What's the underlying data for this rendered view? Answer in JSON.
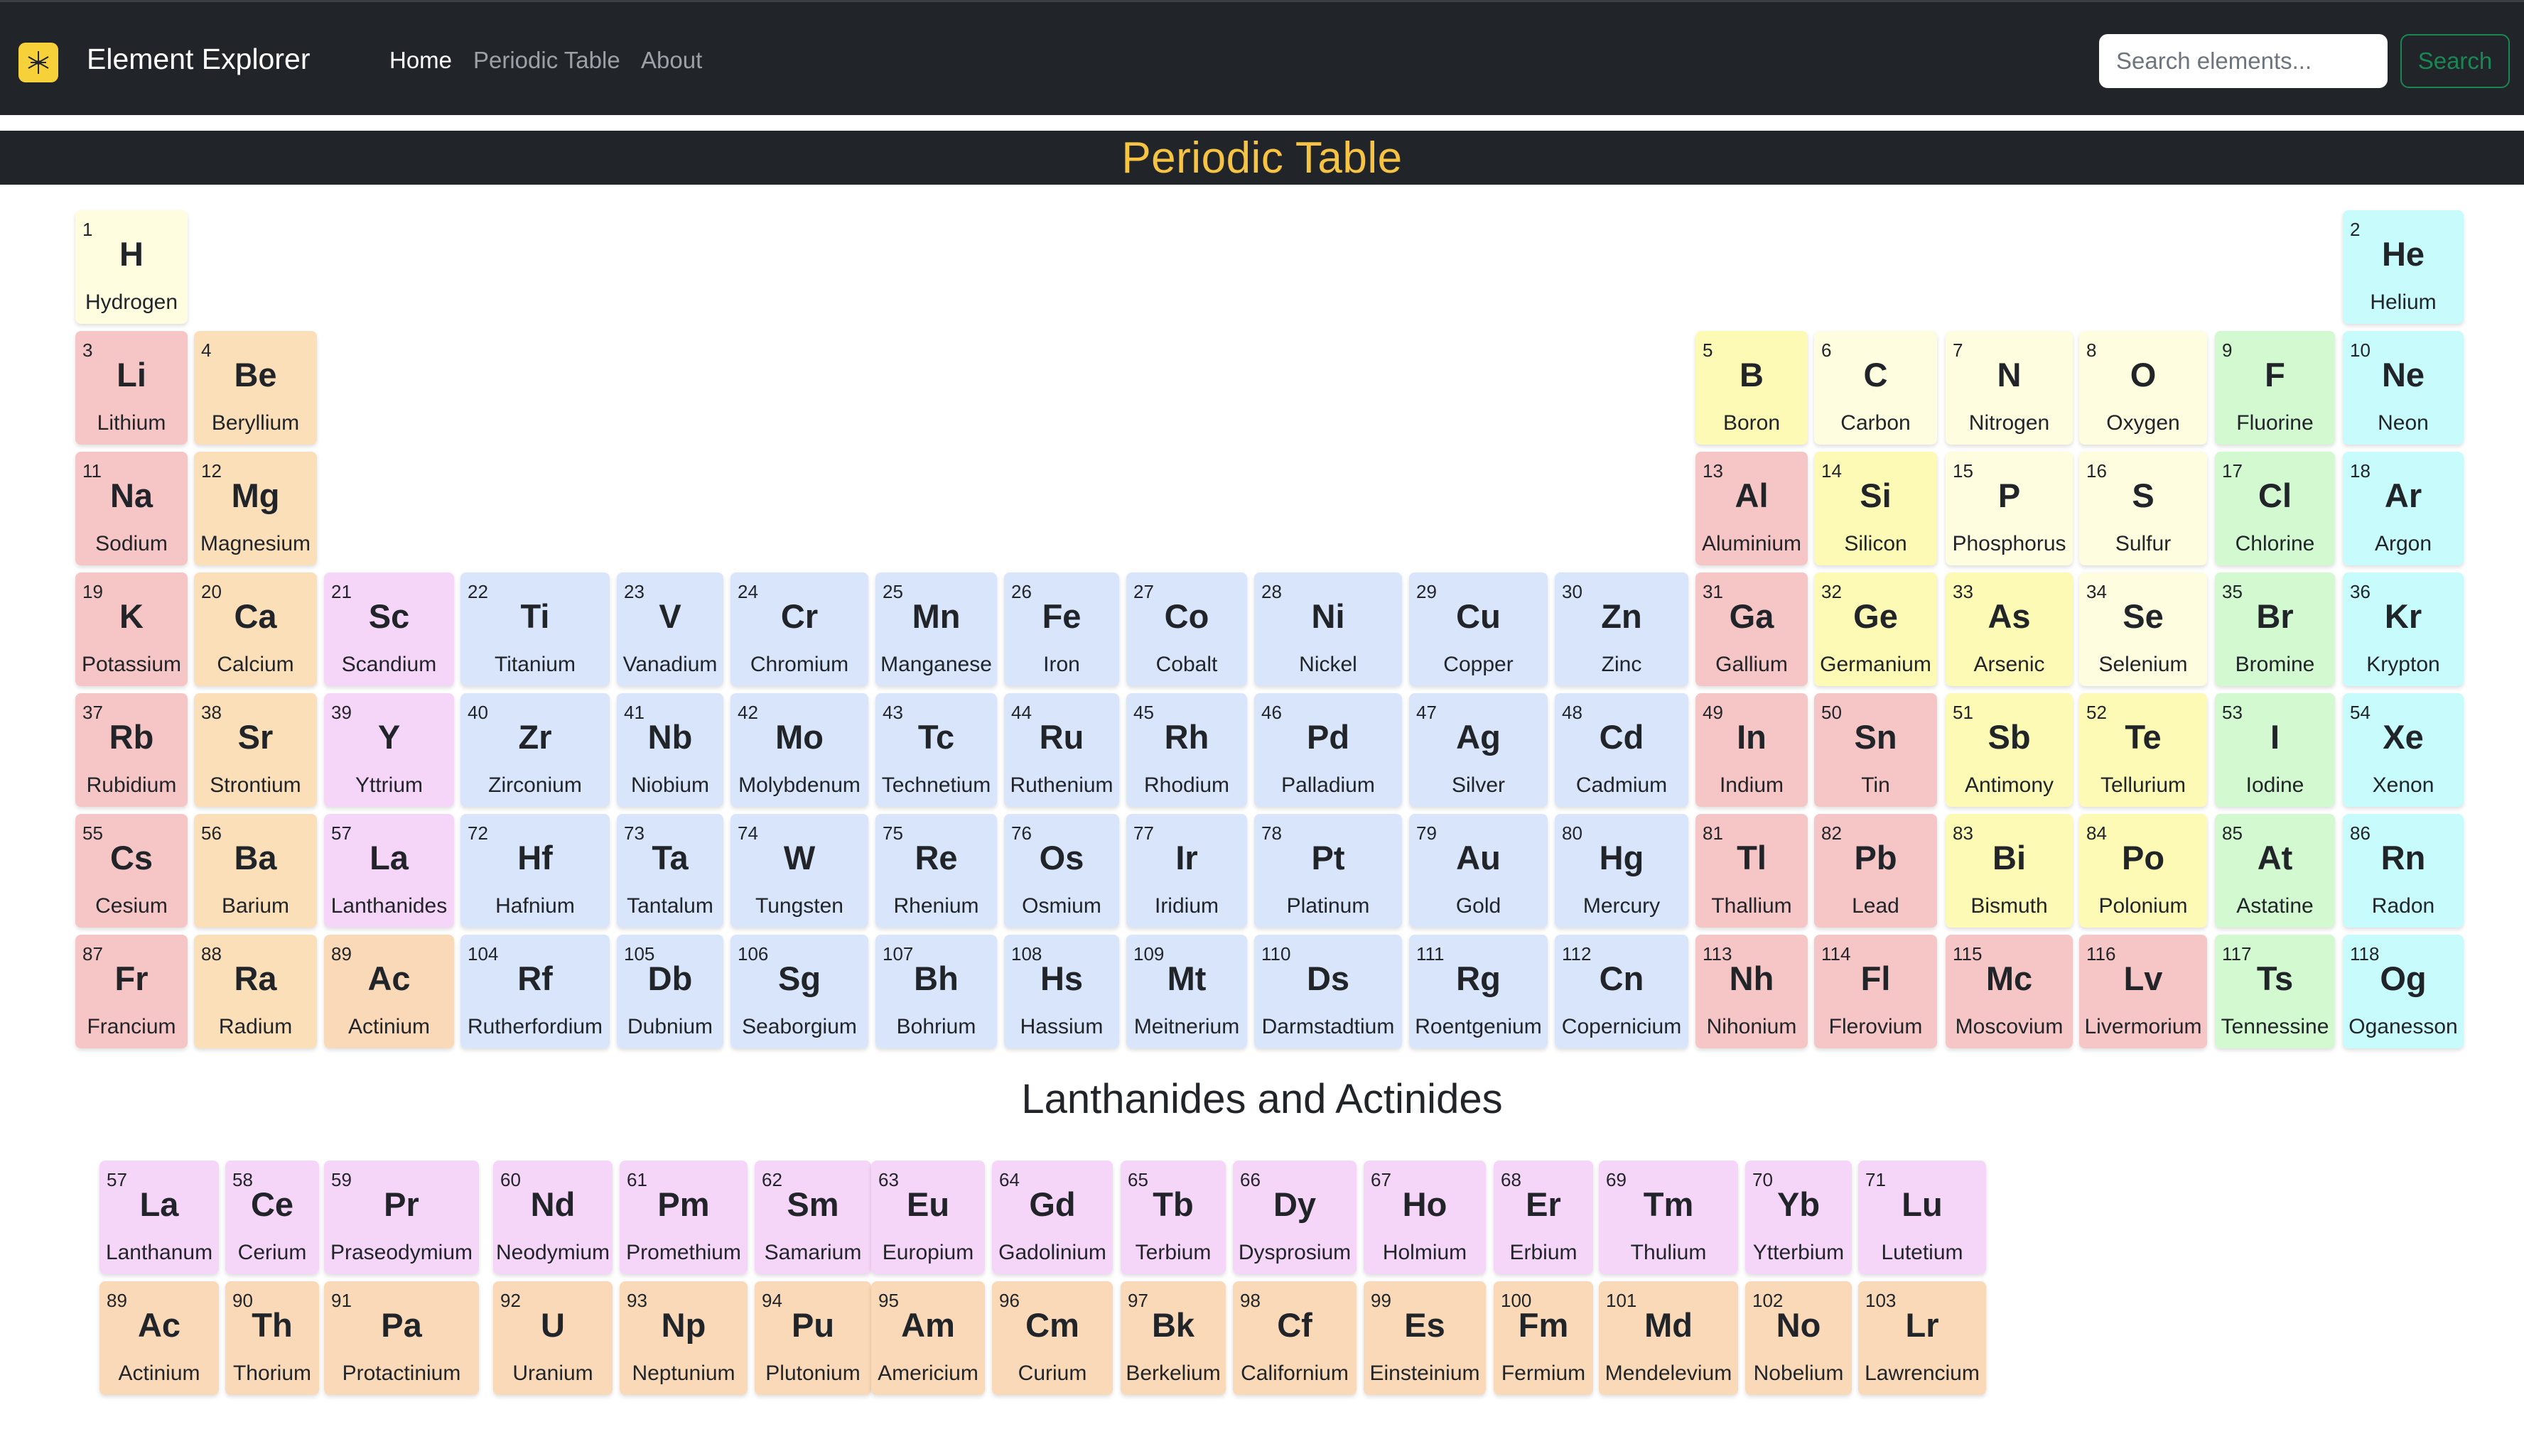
{
  "navbar": {
    "brand": "Element Explorer",
    "links": [
      {
        "label": "Home",
        "active": true
      },
      {
        "label": "Periodic Table",
        "active": false
      },
      {
        "label": "About",
        "active": false
      }
    ],
    "search_placeholder": "Search elements...",
    "search_button": "Search",
    "logo_icon": "atom-icon",
    "background": "#212529"
  },
  "main_title": "Periodic Table",
  "sub_title": "Lanthanides and Actinides",
  "category_colors": {
    "alkali": "#f6c5c5",
    "alkaline": "#fbdfb9",
    "transition": "#d9e5fb",
    "post": "#f6c5c5",
    "metalloid": "#fdfab6",
    "nonmetal": "#fefde0",
    "halogen": "#d2f9cf",
    "noble": "#c8fbfc",
    "lanth": "#f6d6f8",
    "actin": "#f9d9b7"
  },
  "table_rows": [
    [
      {
        "num": "1",
        "sym": "H",
        "name": "Hydrogen",
        "cat": "nonmetal",
        "col": 1
      },
      {
        "num": "2",
        "sym": "He",
        "name": "Helium",
        "cat": "noble",
        "col": 18
      }
    ],
    [
      {
        "num": "3",
        "sym": "Li",
        "name": "Lithium",
        "cat": "alkali",
        "col": 1
      },
      {
        "num": "4",
        "sym": "Be",
        "name": "Beryllium",
        "cat": "alkaline",
        "col": 2
      },
      {
        "num": "5",
        "sym": "B",
        "name": "Boron",
        "cat": "metalloid",
        "col": 13
      },
      {
        "num": "6",
        "sym": "C",
        "name": "Carbon",
        "cat": "nonmetal",
        "col": 14
      },
      {
        "num": "7",
        "sym": "N",
        "name": "Nitrogen",
        "cat": "nonmetal",
        "col": 15
      },
      {
        "num": "8",
        "sym": "O",
        "name": "Oxygen",
        "cat": "nonmetal",
        "col": 16
      },
      {
        "num": "9",
        "sym": "F",
        "name": "Fluorine",
        "cat": "halogen",
        "col": 17
      },
      {
        "num": "10",
        "sym": "Ne",
        "name": "Neon",
        "cat": "noble",
        "col": 18
      }
    ],
    [
      {
        "num": "11",
        "sym": "Na",
        "name": "Sodium",
        "cat": "alkali",
        "col": 1
      },
      {
        "num": "12",
        "sym": "Mg",
        "name": "Magnesium",
        "cat": "alkaline",
        "col": 2
      },
      {
        "num": "13",
        "sym": "Al",
        "name": "Aluminium",
        "cat": "post",
        "col": 13
      },
      {
        "num": "14",
        "sym": "Si",
        "name": "Silicon",
        "cat": "metalloid",
        "col": 14
      },
      {
        "num": "15",
        "sym": "P",
        "name": "Phosphorus",
        "cat": "nonmetal",
        "col": 15
      },
      {
        "num": "16",
        "sym": "S",
        "name": "Sulfur",
        "cat": "nonmetal",
        "col": 16
      },
      {
        "num": "17",
        "sym": "Cl",
        "name": "Chlorine",
        "cat": "halogen",
        "col": 17
      },
      {
        "num": "18",
        "sym": "Ar",
        "name": "Argon",
        "cat": "noble",
        "col": 18
      }
    ],
    [
      {
        "num": "19",
        "sym": "K",
        "name": "Potassium",
        "cat": "alkali",
        "col": 1
      },
      {
        "num": "20",
        "sym": "Ca",
        "name": "Calcium",
        "cat": "alkaline",
        "col": 2
      },
      {
        "num": "21",
        "sym": "Sc",
        "name": "Scandium",
        "cat": "lanth",
        "col": 3
      },
      {
        "num": "22",
        "sym": "Ti",
        "name": "Titanium",
        "cat": "transition",
        "col": 4
      },
      {
        "num": "23",
        "sym": "V",
        "name": "Vanadium",
        "cat": "transition",
        "col": 5
      },
      {
        "num": "24",
        "sym": "Cr",
        "name": "Chromium",
        "cat": "transition",
        "col": 6
      },
      {
        "num": "25",
        "sym": "Mn",
        "name": "Manganese",
        "cat": "transition",
        "col": 7
      },
      {
        "num": "26",
        "sym": "Fe",
        "name": "Iron",
        "cat": "transition",
        "col": 8
      },
      {
        "num": "27",
        "sym": "Co",
        "name": "Cobalt",
        "cat": "transition",
        "col": 9
      },
      {
        "num": "28",
        "sym": "Ni",
        "name": "Nickel",
        "cat": "transition",
        "col": 10
      },
      {
        "num": "29",
        "sym": "Cu",
        "name": "Copper",
        "cat": "transition",
        "col": 11
      },
      {
        "num": "30",
        "sym": "Zn",
        "name": "Zinc",
        "cat": "transition",
        "col": 12
      },
      {
        "num": "31",
        "sym": "Ga",
        "name": "Gallium",
        "cat": "post",
        "col": 13
      },
      {
        "num": "32",
        "sym": "Ge",
        "name": "Germanium",
        "cat": "metalloid",
        "col": 14
      },
      {
        "num": "33",
        "sym": "As",
        "name": "Arsenic",
        "cat": "metalloid",
        "col": 15
      },
      {
        "num": "34",
        "sym": "Se",
        "name": "Selenium",
        "cat": "nonmetal",
        "col": 16
      },
      {
        "num": "35",
        "sym": "Br",
        "name": "Bromine",
        "cat": "halogen",
        "col": 17
      },
      {
        "num": "36",
        "sym": "Kr",
        "name": "Krypton",
        "cat": "noble",
        "col": 18
      }
    ],
    [
      {
        "num": "37",
        "sym": "Rb",
        "name": "Rubidium",
        "cat": "alkali",
        "col": 1
      },
      {
        "num": "38",
        "sym": "Sr",
        "name": "Strontium",
        "cat": "alkaline",
        "col": 2
      },
      {
        "num": "39",
        "sym": "Y",
        "name": "Yttrium",
        "cat": "lanth",
        "col": 3
      },
      {
        "num": "40",
        "sym": "Zr",
        "name": "Zirconium",
        "cat": "transition",
        "col": 4
      },
      {
        "num": "41",
        "sym": "Nb",
        "name": "Niobium",
        "cat": "transition",
        "col": 5
      },
      {
        "num": "42",
        "sym": "Mo",
        "name": "Molybdenum",
        "cat": "transition",
        "col": 6
      },
      {
        "num": "43",
        "sym": "Tc",
        "name": "Technetium",
        "cat": "transition",
        "col": 7
      },
      {
        "num": "44",
        "sym": "Ru",
        "name": "Ruthenium",
        "cat": "transition",
        "col": 8
      },
      {
        "num": "45",
        "sym": "Rh",
        "name": "Rhodium",
        "cat": "transition",
        "col": 9
      },
      {
        "num": "46",
        "sym": "Pd",
        "name": "Palladium",
        "cat": "transition",
        "col": 10
      },
      {
        "num": "47",
        "sym": "Ag",
        "name": "Silver",
        "cat": "transition",
        "col": 11
      },
      {
        "num": "48",
        "sym": "Cd",
        "name": "Cadmium",
        "cat": "transition",
        "col": 12
      },
      {
        "num": "49",
        "sym": "In",
        "name": "Indium",
        "cat": "post",
        "col": 13
      },
      {
        "num": "50",
        "sym": "Sn",
        "name": "Tin",
        "cat": "post",
        "col": 14
      },
      {
        "num": "51",
        "sym": "Sb",
        "name": "Antimony",
        "cat": "metalloid",
        "col": 15
      },
      {
        "num": "52",
        "sym": "Te",
        "name": "Tellurium",
        "cat": "metalloid",
        "col": 16
      },
      {
        "num": "53",
        "sym": "I",
        "name": "Iodine",
        "cat": "halogen",
        "col": 17
      },
      {
        "num": "54",
        "sym": "Xe",
        "name": "Xenon",
        "cat": "noble",
        "col": 18
      }
    ],
    [
      {
        "num": "55",
        "sym": "Cs",
        "name": "Cesium",
        "cat": "alkali",
        "col": 1
      },
      {
        "num": "56",
        "sym": "Ba",
        "name": "Barium",
        "cat": "alkaline",
        "col": 2
      },
      {
        "num": "57",
        "sym": "La",
        "name": "Lanthanides",
        "cat": "lanth",
        "col": 3
      },
      {
        "num": "72",
        "sym": "Hf",
        "name": "Hafnium",
        "cat": "transition",
        "col": 4
      },
      {
        "num": "73",
        "sym": "Ta",
        "name": "Tantalum",
        "cat": "transition",
        "col": 5
      },
      {
        "num": "74",
        "sym": "W",
        "name": "Tungsten",
        "cat": "transition",
        "col": 6
      },
      {
        "num": "75",
        "sym": "Re",
        "name": "Rhenium",
        "cat": "transition",
        "col": 7
      },
      {
        "num": "76",
        "sym": "Os",
        "name": "Osmium",
        "cat": "transition",
        "col": 8
      },
      {
        "num": "77",
        "sym": "Ir",
        "name": "Iridium",
        "cat": "transition",
        "col": 9
      },
      {
        "num": "78",
        "sym": "Pt",
        "name": "Platinum",
        "cat": "transition",
        "col": 10
      },
      {
        "num": "79",
        "sym": "Au",
        "name": "Gold",
        "cat": "transition",
        "col": 11
      },
      {
        "num": "80",
        "sym": "Hg",
        "name": "Mercury",
        "cat": "transition",
        "col": 12
      },
      {
        "num": "81",
        "sym": "Tl",
        "name": "Thallium",
        "cat": "post",
        "col": 13
      },
      {
        "num": "82",
        "sym": "Pb",
        "name": "Lead",
        "cat": "post",
        "col": 14
      },
      {
        "num": "83",
        "sym": "Bi",
        "name": "Bismuth",
        "cat": "metalloid",
        "col": 15
      },
      {
        "num": "84",
        "sym": "Po",
        "name": "Polonium",
        "cat": "metalloid",
        "col": 16
      },
      {
        "num": "85",
        "sym": "At",
        "name": "Astatine",
        "cat": "halogen",
        "col": 17
      },
      {
        "num": "86",
        "sym": "Rn",
        "name": "Radon",
        "cat": "noble",
        "col": 18
      }
    ],
    [
      {
        "num": "87",
        "sym": "Fr",
        "name": "Francium",
        "cat": "alkali",
        "col": 1
      },
      {
        "num": "88",
        "sym": "Ra",
        "name": "Radium",
        "cat": "alkaline",
        "col": 2
      },
      {
        "num": "89",
        "sym": "Ac",
        "name": "Actinium",
        "cat": "actin",
        "col": 3
      },
      {
        "num": "104",
        "sym": "Rf",
        "name": "Rutherfordium",
        "cat": "transition",
        "col": 4
      },
      {
        "num": "105",
        "sym": "Db",
        "name": "Dubnium",
        "cat": "transition",
        "col": 5
      },
      {
        "num": "106",
        "sym": "Sg",
        "name": "Seaborgium",
        "cat": "transition",
        "col": 6
      },
      {
        "num": "107",
        "sym": "Bh",
        "name": "Bohrium",
        "cat": "transition",
        "col": 7
      },
      {
        "num": "108",
        "sym": "Hs",
        "name": "Hassium",
        "cat": "transition",
        "col": 8
      },
      {
        "num": "109",
        "sym": "Mt",
        "name": "Meitnerium",
        "cat": "transition",
        "col": 9
      },
      {
        "num": "110",
        "sym": "Ds",
        "name": "Darmstadtium",
        "cat": "transition",
        "col": 10
      },
      {
        "num": "111",
        "sym": "Rg",
        "name": "Roentgenium",
        "cat": "transition",
        "col": 11
      },
      {
        "num": "112",
        "sym": "Cn",
        "name": "Copernicium",
        "cat": "transition",
        "col": 12
      },
      {
        "num": "113",
        "sym": "Nh",
        "name": "Nihonium",
        "cat": "post",
        "col": 13
      },
      {
        "num": "114",
        "sym": "Fl",
        "name": "Flerovium",
        "cat": "post",
        "col": 14
      },
      {
        "num": "115",
        "sym": "Mc",
        "name": "Moscovium",
        "cat": "post",
        "col": 15
      },
      {
        "num": "116",
        "sym": "Lv",
        "name": "Livermorium",
        "cat": "post",
        "col": 16
      },
      {
        "num": "117",
        "sym": "Ts",
        "name": "Tennessine",
        "cat": "halogen",
        "col": 17
      },
      {
        "num": "118",
        "sym": "Og",
        "name": "Oganesson",
        "cat": "noble",
        "col": 18
      }
    ]
  ],
  "fblock_rows": [
    [
      {
        "num": "57",
        "sym": "La",
        "name": "Lanthanum",
        "cat": "lanth"
      },
      {
        "num": "58",
        "sym": "Ce",
        "name": "Cerium",
        "cat": "lanth"
      },
      {
        "num": "59",
        "sym": "Pr",
        "name": "Praseodymium",
        "cat": "lanth"
      },
      {
        "num": "60",
        "sym": "Nd",
        "name": "Neodymium",
        "cat": "lanth"
      },
      {
        "num": "61",
        "sym": "Pm",
        "name": "Promethium",
        "cat": "lanth"
      },
      {
        "num": "62",
        "sym": "Sm",
        "name": "Samarium",
        "cat": "lanth"
      },
      {
        "num": "63",
        "sym": "Eu",
        "name": "Europium",
        "cat": "lanth"
      },
      {
        "num": "64",
        "sym": "Gd",
        "name": "Gadolinium",
        "cat": "lanth"
      },
      {
        "num": "65",
        "sym": "Tb",
        "name": "Terbium",
        "cat": "lanth"
      },
      {
        "num": "66",
        "sym": "Dy",
        "name": "Dysprosium",
        "cat": "lanth"
      },
      {
        "num": "67",
        "sym": "Ho",
        "name": "Holmium",
        "cat": "lanth"
      },
      {
        "num": "68",
        "sym": "Er",
        "name": "Erbium",
        "cat": "lanth"
      },
      {
        "num": "69",
        "sym": "Tm",
        "name": "Thulium",
        "cat": "lanth"
      },
      {
        "num": "70",
        "sym": "Yb",
        "name": "Ytterbium",
        "cat": "lanth"
      },
      {
        "num": "71",
        "sym": "Lu",
        "name": "Lutetium",
        "cat": "lanth"
      }
    ],
    [
      {
        "num": "89",
        "sym": "Ac",
        "name": "Actinium",
        "cat": "actin"
      },
      {
        "num": "90",
        "sym": "Th",
        "name": "Thorium",
        "cat": "actin"
      },
      {
        "num": "91",
        "sym": "Pa",
        "name": "Protactinium",
        "cat": "actin"
      },
      {
        "num": "92",
        "sym": "U",
        "name": "Uranium",
        "cat": "actin"
      },
      {
        "num": "93",
        "sym": "Np",
        "name": "Neptunium",
        "cat": "actin"
      },
      {
        "num": "94",
        "sym": "Pu",
        "name": "Plutonium",
        "cat": "actin"
      },
      {
        "num": "95",
        "sym": "Am",
        "name": "Americium",
        "cat": "actin"
      },
      {
        "num": "96",
        "sym": "Cm",
        "name": "Curium",
        "cat": "actin"
      },
      {
        "num": "97",
        "sym": "Bk",
        "name": "Berkelium",
        "cat": "actin"
      },
      {
        "num": "98",
        "sym": "Cf",
        "name": "Californium",
        "cat": "actin"
      },
      {
        "num": "99",
        "sym": "Es",
        "name": "Einsteinium",
        "cat": "actin"
      },
      {
        "num": "100",
        "sym": "Fm",
        "name": "Fermium",
        "cat": "actin"
      },
      {
        "num": "101",
        "sym": "Md",
        "name": "Mendelevium",
        "cat": "actin"
      },
      {
        "num": "102",
        "sym": "No",
        "name": "Nobelium",
        "cat": "actin"
      },
      {
        "num": "103",
        "sym": "Lr",
        "name": "Lawrencium",
        "cat": "actin"
      }
    ]
  ]
}
